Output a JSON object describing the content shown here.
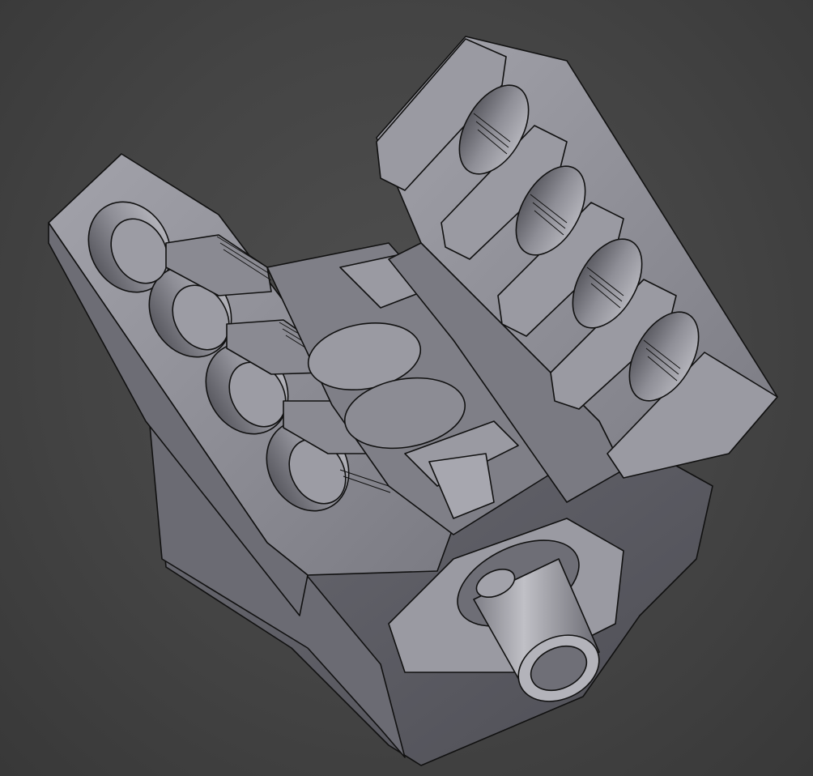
{
  "viewport": {
    "background_color": "#474747",
    "model_face_color": "#8c8c94",
    "model_shadow_color": "#5c5c63",
    "model_edge_color": "#111111"
  },
  "model": {
    "name_icon": "v8-engine-block-model",
    "left_bank_cylinders": 4,
    "right_bank_cylinders": 4
  }
}
